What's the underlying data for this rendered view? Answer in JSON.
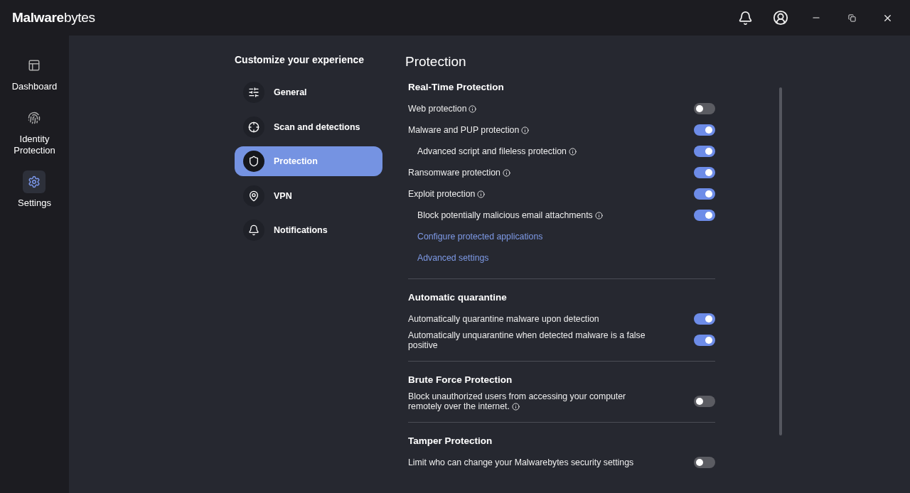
{
  "app": {
    "logo": "**Malware**bytes"
  },
  "rail": [
    {
      "label": "Dashboard",
      "selected": false
    },
    {
      "label": "Identity\nProtection",
      "selected": false
    },
    {
      "label": "Settings",
      "selected": true
    }
  ],
  "settings_menu": {
    "title": "Customize your experience",
    "items": [
      {
        "label": "General",
        "selected": false
      },
      {
        "label": "Scan and detections",
        "selected": false
      },
      {
        "label": "Protection",
        "selected": true
      },
      {
        "label": "VPN",
        "selected": false
      },
      {
        "label": "Notifications",
        "selected": false
      }
    ]
  },
  "page": {
    "title": "Protection",
    "sections": [
      {
        "title": "Real-Time Protection",
        "rows": [
          {
            "kind": "toggle",
            "label": "Web protection",
            "info": true,
            "on": false
          },
          {
            "kind": "toggle",
            "label": "Malware and PUP protection",
            "info": true,
            "on": true,
            "children": [
              {
                "kind": "toggle",
                "label": "Advanced script and fileless protection",
                "info": true,
                "on": true
              }
            ]
          },
          {
            "kind": "toggle",
            "label": "Ransomware protection",
            "info": true,
            "on": true
          },
          {
            "kind": "toggle",
            "label": "Exploit protection",
            "info": true,
            "on": true,
            "children": [
              {
                "kind": "toggle",
                "label": "Block potentially malicious email attachments",
                "info": true,
                "on": true
              },
              {
                "kind": "link",
                "label": "Configure protected applications"
              },
              {
                "kind": "link",
                "label": "Advanced settings"
              }
            ]
          }
        ]
      },
      {
        "title": "Automatic quarantine",
        "rows": [
          {
            "kind": "toggle",
            "label": "Automatically quarantine malware upon detection",
            "info": false,
            "on": true
          },
          {
            "kind": "toggle",
            "label": "Automatically unquarantine when detected malware is a false positive",
            "info": false,
            "on": true
          }
        ]
      },
      {
        "title": "Brute Force Protection",
        "rows": [
          {
            "kind": "toggle",
            "label": "Block unauthorized users from accessing your computer remotely over the internet.",
            "info": true,
            "on": false
          }
        ]
      },
      {
        "title": "Tamper Protection",
        "rows": [
          {
            "kind": "toggle",
            "label": "Limit who can change your Malwarebytes security settings",
            "info": false,
            "on": false
          }
        ]
      }
    ]
  }
}
